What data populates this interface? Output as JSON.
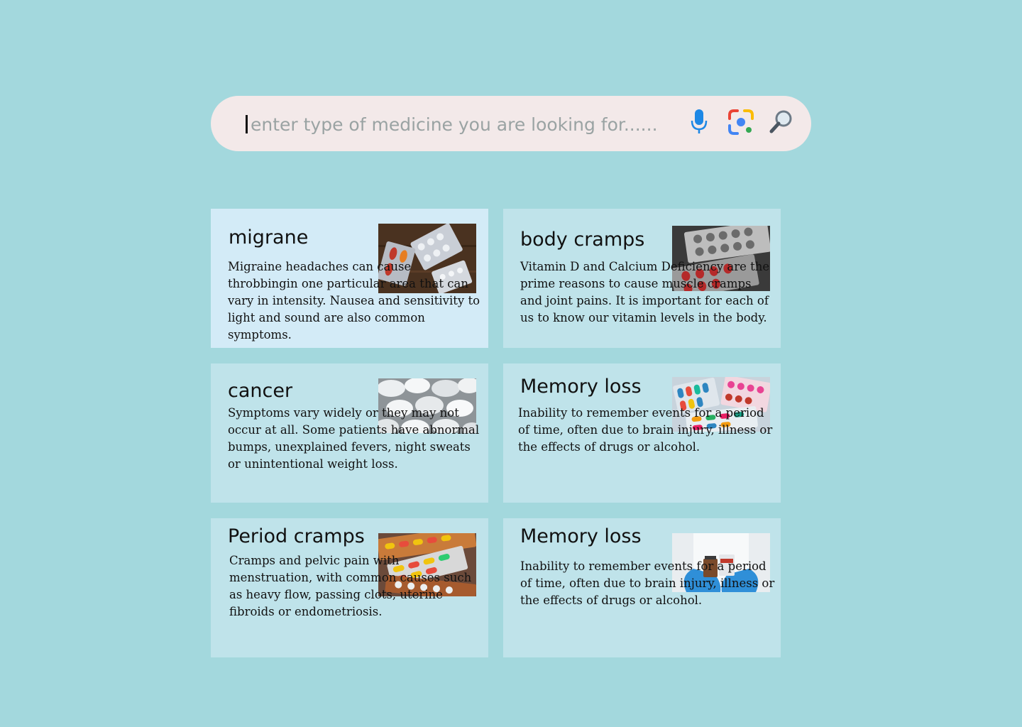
{
  "search": {
    "placeholder": "enter type of medicine you are looking for......",
    "mic_icon": "microphone-icon",
    "lens_icon": "camera-lens-icon",
    "search_icon": "magnifier-icon"
  },
  "cards": [
    {
      "title": "migrane",
      "text": "Migraine headaches can cause throbbingin one particular area that can vary in intensity. Nausea and sensitivity to light and sound are also common symptoms.",
      "image": "pill-blister-packs-on-wood"
    },
    {
      "title": "body cramps",
      "text": "Vitamin D and Calcium Deficiency are the prime reasons to cause muscle cramps and joint pains. It is important for each of us to know our vitamin levels in the body.",
      "image": "grey-and-red-pill-blisters"
    },
    {
      "title": "cancer",
      "text": "Symptoms vary widely or  they may not occur at all. Some patients have abnormal bumps, unexplained fevers, night sweats or unintentional weight loss.",
      "image": "white-tablets"
    },
    {
      "title": "Memory loss",
      "text": "Inability to remember events for a period of time, often due to brain injury, illness or the effects of drugs or alcohol.",
      "image": "colorful-capsule-blisters"
    },
    {
      "title": "Period cramps",
      "text": "Cramps and pelvic pain with menstruation, with common causes such as heavy flow, passing clots, uterine fibroids or endometriosis.",
      "image": "stacked-colorful-pill-packs"
    },
    {
      "title": "Memory loss",
      "text": "Inability to remember events for a period of time, often due to brain injury, illness or the effects of drugs or alcohol.",
      "image": "gloved-hands-holding-medicine"
    }
  ]
}
